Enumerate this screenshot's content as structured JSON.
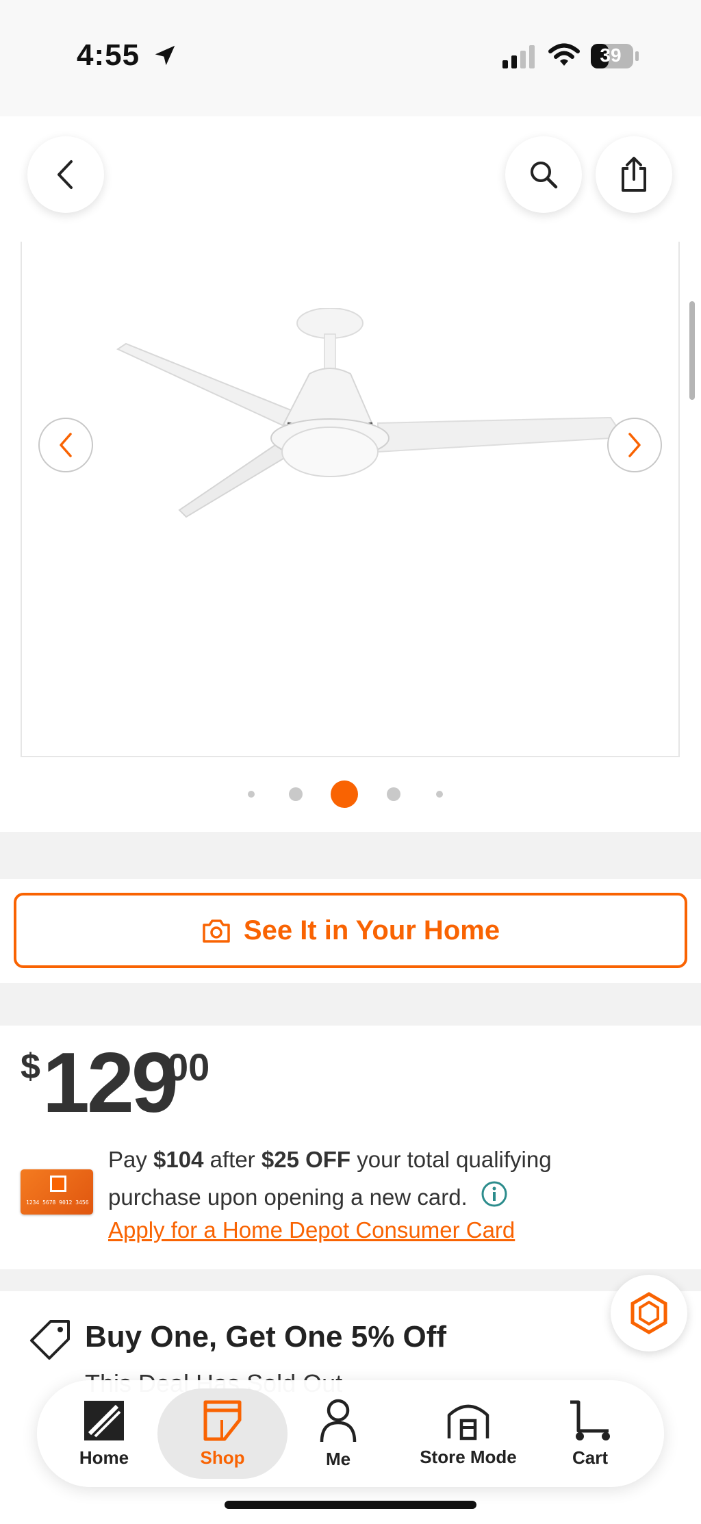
{
  "status_bar": {
    "time": "4:55",
    "battery": "39"
  },
  "header": {
    "back_icon": "chevron-left-icon",
    "search_icon": "search-icon",
    "share_icon": "share-icon"
  },
  "gallery": {
    "image_alt": "white ceiling fan",
    "prev_icon": "chevron-left-icon",
    "next_icon": "chevron-right-icon",
    "dot_count": 5,
    "active_dot": 3
  },
  "ar": {
    "label": "See It in Your Home",
    "icon": "camera-icon"
  },
  "price": {
    "currency": "$",
    "dollars": "129",
    "cents": "00"
  },
  "promo": {
    "pay": "Pay",
    "amount": "$104",
    "after": "after",
    "discount": "$25 OFF",
    "rest_line1": "your total qualifying",
    "line2": "purchase upon opening a new card.",
    "apply_link": "Apply for a Home Depot Consumer Card",
    "card_number": "1234 5678 9012 3456"
  },
  "deal": {
    "title": "Buy One, Get One 5% Off",
    "subtitle": "This Deal Has Sold Out"
  },
  "bottom_nav": {
    "items": [
      {
        "label": "Home",
        "icon": "home-depot-logo-icon"
      },
      {
        "label": "Shop",
        "icon": "shop-icon"
      },
      {
        "label": "Me",
        "icon": "person-icon"
      },
      {
        "label": "Store Mode",
        "icon": "store-icon"
      },
      {
        "label": "Cart",
        "icon": "cart-icon"
      }
    ],
    "active": "Shop"
  },
  "colors": {
    "brand_orange": "#f96302",
    "text_dark": "#333333",
    "background": "#f2f2f2"
  }
}
